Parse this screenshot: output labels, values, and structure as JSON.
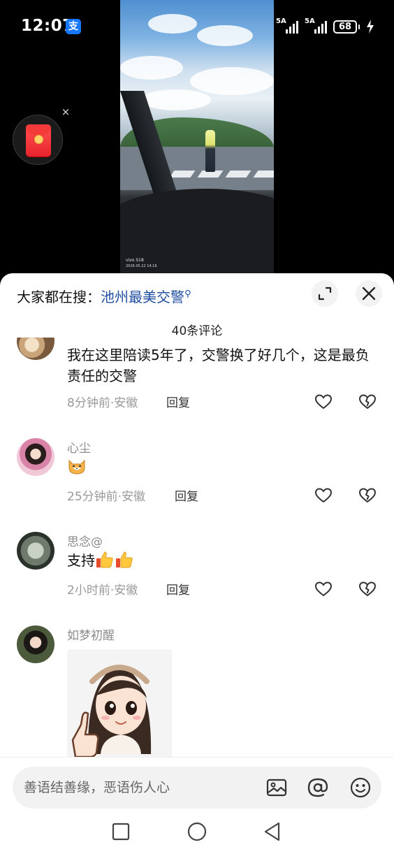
{
  "status_bar": {
    "time": "12:07",
    "alipay_badge": "支",
    "signal_1_label": "5A",
    "signal_2_label": "5A",
    "battery_level": "68"
  },
  "video": {
    "watermark_brand": "vivo S18",
    "watermark_date": "2026.05.22 14:16"
  },
  "sheet": {
    "search_prefix": "大家都在搜：",
    "search_term": "池州最美交警",
    "comment_count": "40条评论"
  },
  "comments": [
    {
      "username": "",
      "text": "我在这里陪读5年了，交警换了好几个，这是最负责任的交警",
      "time": "8分钟前",
      "location": "安徽",
      "meta": "8分钟前·安徽",
      "reply_label": "回复"
    },
    {
      "username": "心尘",
      "text": "",
      "emoji": "cat-face-emoji",
      "time": "25分钟前",
      "location": "安徽",
      "meta": "25分钟前·安徽",
      "reply_label": "回复"
    },
    {
      "username": "思念@",
      "text": "支持",
      "emoji": "thumbs-up-emoji x2",
      "time": "2小时前",
      "location": "安徽",
      "meta": "2小时前·安徽",
      "reply_label": "回复"
    },
    {
      "username": "如梦初醒",
      "image": "cartoon-girl-thumbs-up-sticker"
    }
  ],
  "input_bar": {
    "placeholder": "善语结善缘，恶语伤人心",
    "icons": [
      "image-icon",
      "at-icon",
      "emoji-icon"
    ]
  },
  "nav_bar": {
    "icons": [
      "recents-square-icon",
      "home-circle-icon",
      "back-triangle-icon"
    ]
  },
  "colors": {
    "search_term": "#1f4fa0",
    "red_packet": "#e8232b",
    "sheet_bg": "#ffffff",
    "meta_text": "#9a9a9a"
  }
}
